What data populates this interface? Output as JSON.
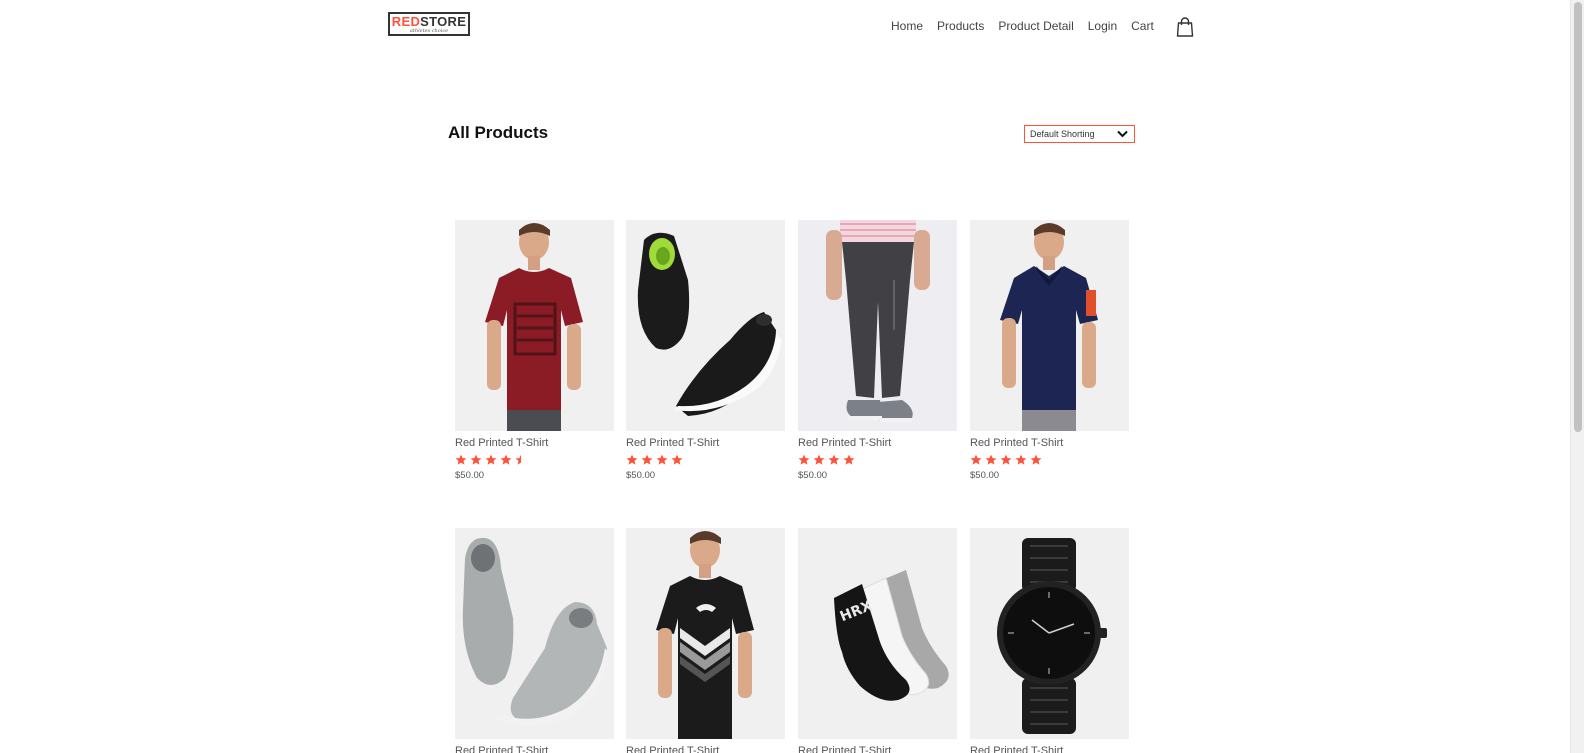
{
  "logo": {
    "brand_red": "RED",
    "brand_dark": "STORE",
    "tagline": "athletes choice"
  },
  "nav": {
    "items": [
      "Home",
      "Products",
      "Product Detail",
      "Login",
      "Cart"
    ],
    "cart_icon": "shopping-bag-icon"
  },
  "title": "All Products",
  "sort": {
    "selected": "Default Shorting",
    "icon": "chevron-down-icon"
  },
  "colors": {
    "accent": "#ff523b",
    "card_bg": "#f0f0f0",
    "text": "#555555"
  },
  "products": [
    {
      "image": "red-tshirt",
      "name": "Red Printed T-Shirt",
      "rating": 4.5,
      "price": "$50.00"
    },
    {
      "image": "black-sneakers",
      "name": "Red Printed T-Shirt",
      "rating": 4,
      "price": "$50.00"
    },
    {
      "image": "grey-joggers",
      "name": "Red Printed T-Shirt",
      "rating": 4,
      "price": "$50.00"
    },
    {
      "image": "navy-polo",
      "name": "Red Printed T-Shirt",
      "rating": 5,
      "price": "$50.00"
    },
    {
      "image": "grey-high-tops",
      "name": "Red Printed T-Shirt",
      "rating": 0,
      "price": ""
    },
    {
      "image": "black-puma-tshirt",
      "name": "Red Printed T-Shirt",
      "rating": 0,
      "price": ""
    },
    {
      "image": "socks",
      "name": "Red Printed T-Shirt",
      "rating": 0,
      "price": ""
    },
    {
      "image": "black-watch",
      "name": "Red Printed T-Shirt",
      "rating": 0,
      "price": ""
    }
  ]
}
